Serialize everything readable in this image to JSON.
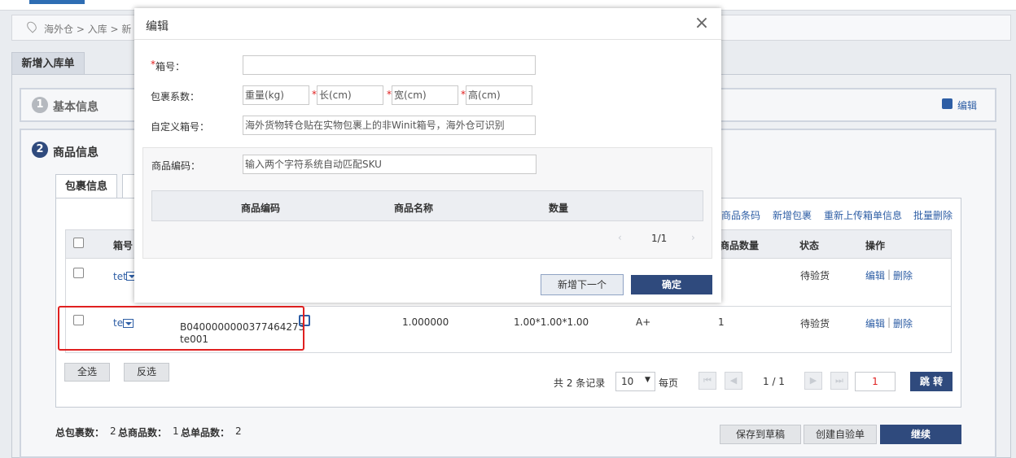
{
  "breadcrumb": "海外仓 > 入库 > 新",
  "page_tab": "新增入库单",
  "section1": {
    "num": "1",
    "title": "基本信息",
    "edit": "编辑"
  },
  "section2": {
    "num": "2",
    "title": "商品信息"
  },
  "inner_tab": "包裹信息",
  "toolbar": {
    "barcode": "商品条码",
    "add_package": "新增包裹",
    "reupload": "重新上传箱单信息",
    "batch_delete": "批量删除"
  },
  "table": {
    "headers": {
      "box_no": "箱号",
      "qty": "商品数量",
      "status": "状态",
      "ops": "操作"
    },
    "rows": [
      {
        "box": "tet",
        "qty": "",
        "status": "待验货",
        "edit": "编辑",
        "sep": "|",
        "delete": "删除"
      },
      {
        "box": "te",
        "code": "B0400000000377464273",
        "name": "te001",
        "weight": "1.000000",
        "size": "1.00*1.00*1.00",
        "grade": "A+",
        "qty": "1",
        "status": "待验货",
        "edit": "编辑",
        "sep": "|",
        "delete": "删除"
      }
    ]
  },
  "select_all": "全选",
  "invert": "反选",
  "pager": {
    "total": "共 2 条记录",
    "page_size": "10",
    "per_page": "每页",
    "page": "1 / 1",
    "jump_value": "1",
    "jump": "跳 转"
  },
  "summary": {
    "pkg_label": "总包裹数：",
    "pkg_value": "2",
    "item_label": "总商品数：",
    "item_value": "1",
    "sku_label": "总单品数：",
    "sku_value": "2"
  },
  "footer_buttons": {
    "save_draft": "保存到草稿",
    "create_self": "创建自验单",
    "continue": "继续"
  },
  "modal": {
    "title": "编辑",
    "box_no_label": "箱号：",
    "box_no_value": "",
    "package_label": "包裹系数：",
    "weight_ph": "重量(kg)",
    "length_ph": "长(cm)",
    "width_ph": "宽(cm)",
    "height_ph": "高(cm)",
    "custom_label": "自定义箱号：",
    "custom_ph": "海外货物转仓贴在实物包裹上的非Winit箱号，海外仓可识别",
    "sku_label": "商品编码：",
    "sku_ph": "输入两个字符系统自动匹配SKU",
    "sku_headers": {
      "code": "商品编码",
      "name": "商品名称",
      "qty": "数量"
    },
    "sku_page": "1/1",
    "add_next": "新增下一个",
    "confirm": "确定"
  },
  "colors": {
    "navy": "#2f4a7d",
    "link": "#2e5ea5",
    "required": "#e02020",
    "circle1": "#b5b9bf",
    "circle2": "#2f4a7d"
  }
}
